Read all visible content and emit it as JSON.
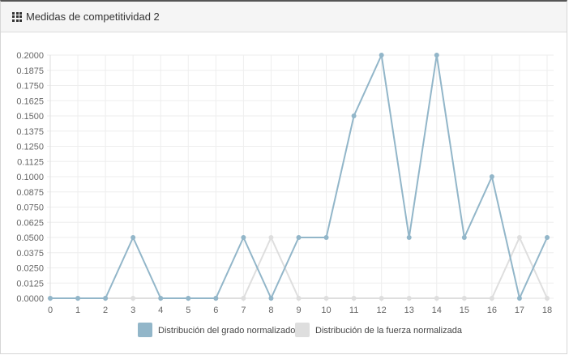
{
  "header": {
    "title": "Medidas de competitividad 2",
    "icon": "grid-icon"
  },
  "chart_data": {
    "type": "line",
    "title": "",
    "xlabel": "",
    "ylabel": "",
    "x": [
      0,
      1,
      2,
      3,
      4,
      5,
      6,
      7,
      8,
      9,
      10,
      11,
      12,
      13,
      14,
      15,
      16,
      17,
      18
    ],
    "ylim": [
      0,
      0.2
    ],
    "y_ticks": [
      "0.0000",
      "0.0125",
      "0.0250",
      "0.0375",
      "0.0500",
      "0.0625",
      "0.0750",
      "0.0875",
      "0.1000",
      "0.1125",
      "0.1250",
      "0.1375",
      "0.1500",
      "0.1625",
      "0.1750",
      "0.1875",
      "0.2000"
    ],
    "grid": true,
    "legend_position": "bottom",
    "series": [
      {
        "name": "Distribución del grado normalizado",
        "color": "#92b6c9",
        "values": [
          0,
          0,
          0,
          0.05,
          0,
          0,
          0,
          0.05,
          0,
          0.05,
          0.05,
          0.15,
          0.2,
          0.05,
          0.2,
          0.05,
          0.1,
          0,
          0.05
        ]
      },
      {
        "name": "Distribución de la fuerza normalizada",
        "color": "#dedede",
        "values": [
          0,
          0,
          0,
          0,
          0,
          0,
          0,
          0,
          0.05,
          0,
          0,
          0,
          0,
          0,
          0,
          0,
          0,
          0.05,
          0
        ]
      }
    ]
  }
}
